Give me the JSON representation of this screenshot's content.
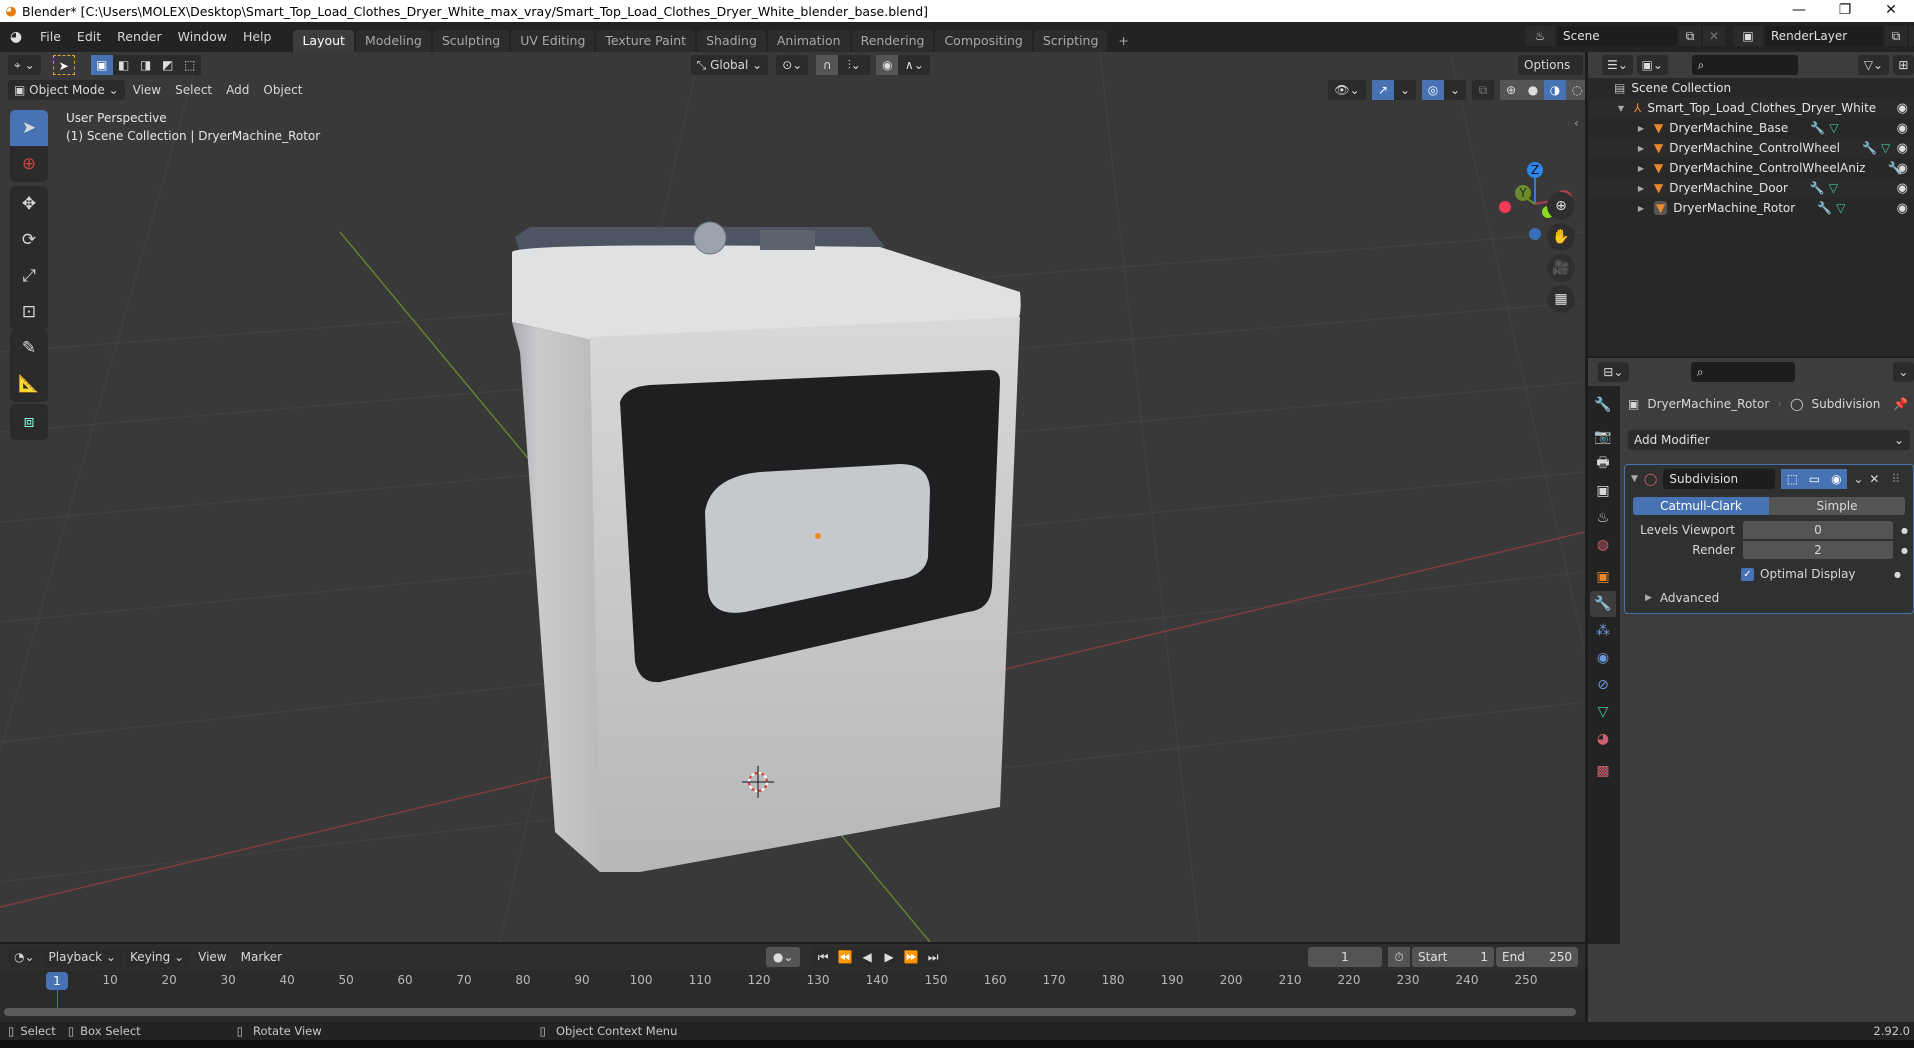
{
  "window": {
    "title": "Blender* [C:\\Users\\MOLEX\\Desktop\\Smart_Top_Load_Clothes_Dryer_White_max_vray/Smart_Top_Load_Clothes_Dryer_White_blender_base.blend]",
    "minimize": "—",
    "maximize": "❐",
    "close": "✕"
  },
  "menu": [
    "File",
    "Edit",
    "Render",
    "Window",
    "Help"
  ],
  "workspaces": [
    "Layout",
    "Modeling",
    "Sculpting",
    "UV Editing",
    "Texture Paint",
    "Shading",
    "Animation",
    "Rendering",
    "Compositing",
    "Scripting"
  ],
  "add_workspace": "+",
  "scene": {
    "name": "Scene",
    "render_layer": "RenderLayer"
  },
  "viewport": {
    "mode": "Object Mode",
    "menus": [
      "View",
      "Select",
      "Add",
      "Object"
    ],
    "orientation": "Global",
    "options": "Options",
    "overlay_line1": "User Perspective",
    "overlay_line2": "(1) Scene Collection | DryerMachine_Rotor",
    "gizmo": {
      "x": "X",
      "y": "Y",
      "z": "Z"
    }
  },
  "outliner": {
    "root": "Scene Collection",
    "collection": "Smart_Top_Load_Clothes_Dryer_White",
    "objects": [
      {
        "name": "DryerMachine_Base",
        "modifier": true,
        "mesh": true
      },
      {
        "name": "DryerMachine_ControlWheel",
        "modifier": true,
        "mesh": true
      },
      {
        "name": "DryerMachine_ControlWheelAniz",
        "modifier": true,
        "mesh": false
      },
      {
        "name": "DryerMachine_Door",
        "modifier": true,
        "mesh": true
      },
      {
        "name": "DryerMachine_Rotor",
        "modifier": true,
        "mesh": true
      }
    ]
  },
  "properties": {
    "breadcrumb_object": "DryerMachine_Rotor",
    "breadcrumb_modifier": "Subdivision",
    "add_modifier": "Add Modifier",
    "modifier": {
      "name": "Subdivision",
      "type_options": [
        "Catmull-Clark",
        "Simple"
      ],
      "selected_type": "Catmull-Clark",
      "levels_viewport_label": "Levels Viewport",
      "levels_viewport": "0",
      "render_label": "Render",
      "render": "2",
      "optimal_display_label": "Optimal Display",
      "optimal_display": true,
      "advanced": "Advanced"
    }
  },
  "timeline": {
    "menus": [
      "Playback",
      "Keying",
      "View",
      "Marker"
    ],
    "current_frame": "1",
    "start_label": "Start",
    "start": "1",
    "end_label": "End",
    "end": "250",
    "ticks": [
      "1",
      "10",
      "20",
      "30",
      "40",
      "50",
      "60",
      "70",
      "80",
      "90",
      "100",
      "110",
      "120",
      "130",
      "140",
      "150",
      "160",
      "170",
      "180",
      "190",
      "200",
      "210",
      "220",
      "230",
      "240",
      "250"
    ]
  },
  "statusbar": {
    "select": "Select",
    "box_select": "Box Select",
    "rotate_view": "Rotate View",
    "context_menu": "Object Context Menu",
    "version": "2.92.0"
  },
  "colors": {
    "accent": "#4772b3",
    "object_orange": "#e8892d",
    "mesh_green": "#3ec7a1",
    "modifier_blue": "#6f9ae0"
  }
}
